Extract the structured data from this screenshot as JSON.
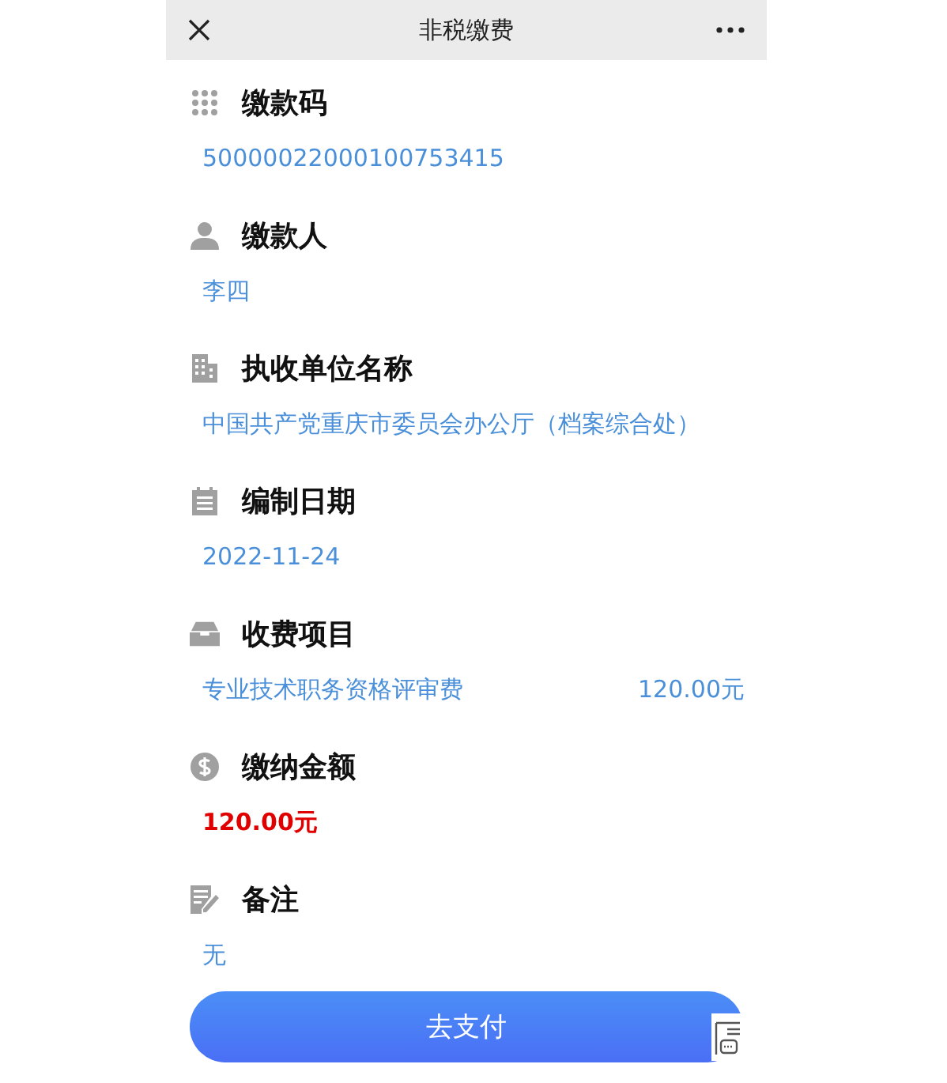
{
  "header": {
    "title": "非税缴费"
  },
  "fields": [
    {
      "kind": "text",
      "label": "缴款码",
      "value": "50000022000100753415"
    },
    {
      "kind": "text",
      "label": "缴款人",
      "value": "李四"
    },
    {
      "kind": "text",
      "label": "执收单位名称",
      "value": "中国共产党重庆市委员会办公厅（档案综合处）"
    },
    {
      "kind": "text",
      "label": "编制日期",
      "value": "2022-11-24"
    },
    {
      "kind": "item",
      "label": "收费项目",
      "value": "专业技术职务资格评审费",
      "amount": "120.00元"
    },
    {
      "kind": "amount",
      "label": "缴纳金额",
      "value": "120.00元"
    },
    {
      "kind": "text",
      "label": "备注",
      "value": "无"
    }
  ],
  "pay_button": "去支付"
}
